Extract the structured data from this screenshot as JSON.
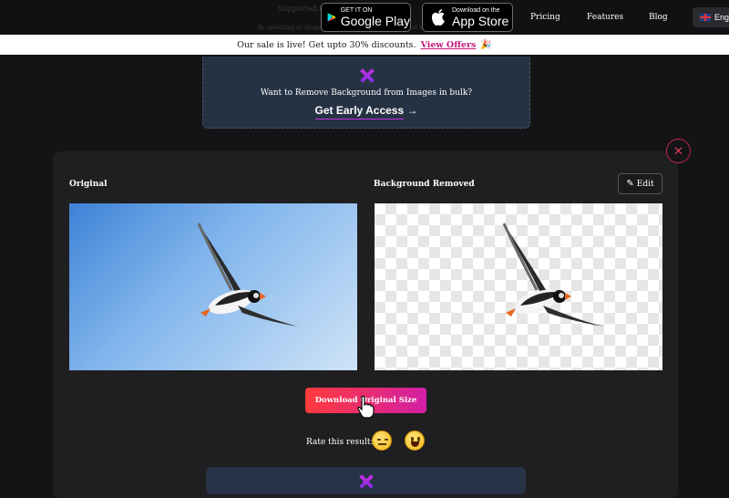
{
  "header": {
    "faint_text_1": "Supported fo",
    "faint_text_2": "By uploading an image or URL you agree to our Terms of Service",
    "google_play": {
      "small": "GET IT ON",
      "big": "Google Play"
    },
    "app_store": {
      "small": "Download on the",
      "big": "App Store"
    },
    "nav": [
      "Pricing",
      "Features",
      "Blog"
    ],
    "language": "Eng"
  },
  "banner": {
    "text": "Our sale is live! Get upto 30% discounts.",
    "link": "View Offers",
    "emoji": "🎉"
  },
  "bulk": {
    "text": "Want to Remove Background from Images in bulk?",
    "cta": "Get Early Access",
    "cta_arrow": "→"
  },
  "result": {
    "close": "✕",
    "original_label": "Original",
    "removed_label": "Background Removed",
    "edit_label": "Edit",
    "download_label": "Download Original Size",
    "rate_label": "Rate this result:"
  },
  "colors": {
    "accent": "#c2187a",
    "download_start": "#ff3b3b",
    "download_end": "#d21fa5",
    "bulk_bg": "#253244"
  },
  "icons": [
    "google-play-icon",
    "apple-icon",
    "uk-flag-icon",
    "party-icon",
    "brand-x-icon",
    "close-icon",
    "pencil-icon",
    "hand-cursor-icon",
    "sad-face-icon",
    "happy-face-icon"
  ]
}
